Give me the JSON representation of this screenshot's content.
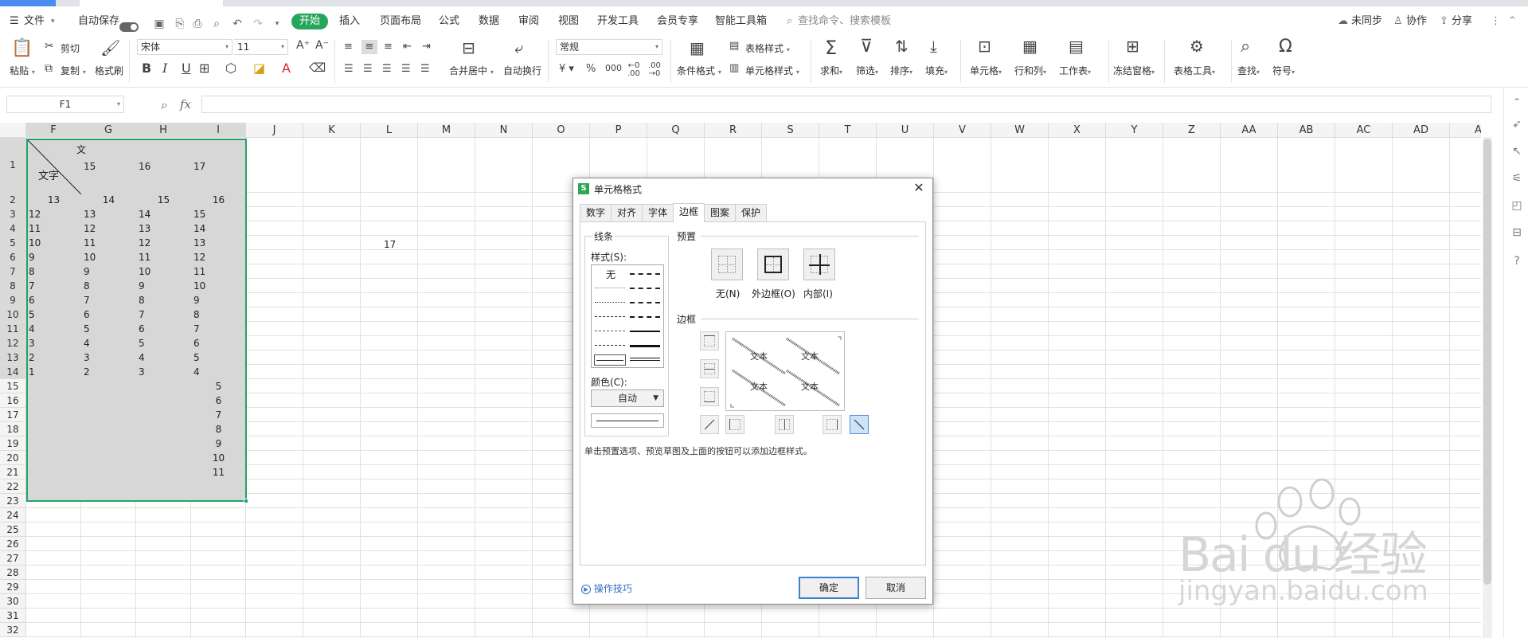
{
  "menubar": {
    "file": "文件",
    "autosave": "自动保存",
    "tabs": [
      "开始",
      "插入",
      "页面布局",
      "公式",
      "数据",
      "审阅",
      "视图",
      "开发工具",
      "会员专享",
      "智能工具箱"
    ],
    "search_placeholder": "查找命令、搜索模板",
    "sync": "未同步",
    "collab": "协作",
    "share": "分享"
  },
  "ribbon": {
    "paste": "粘贴",
    "cut": "剪切",
    "copy": "复制",
    "format_painter": "格式刷",
    "font_name": "宋体",
    "font_size": "11",
    "merge_center": "合并居中",
    "wrap": "自动换行",
    "number_format": "常规",
    "cond_format": "条件格式",
    "table_style": "表格样式",
    "cell_style": "单元格样式",
    "sum": "求和",
    "filter": "筛选",
    "sort": "排序",
    "fill": "填充",
    "cell": "单元格",
    "row_col": "行和列",
    "worksheet": "工作表",
    "freeze": "冻结窗格",
    "table_tools": "表格工具",
    "find": "查找",
    "symbol": "符号"
  },
  "formula": {
    "namebox": "F1",
    "fx": "fx"
  },
  "grid": {
    "columns": [
      "F",
      "G",
      "H",
      "I",
      "J",
      "K",
      "L",
      "M",
      "N",
      "O",
      "P",
      "Q",
      "R",
      "S",
      "T",
      "U",
      "V",
      "W",
      "X",
      "Y",
      "Z",
      "AA",
      "AB",
      "AC",
      "AD",
      "A"
    ],
    "rows": [
      "1",
      "2",
      "3",
      "4",
      "5",
      "6",
      "7",
      "8",
      "9",
      "10",
      "11",
      "12",
      "13",
      "14",
      "15",
      "16",
      "17",
      "18",
      "19",
      "20",
      "21",
      "22",
      "23",
      "24",
      "25",
      "26",
      "27",
      "28",
      "29",
      "30",
      "31",
      "32"
    ],
    "row1": {
      "diag_top": "文",
      "diag_bottom": "文字",
      "g": "15",
      "h": "16",
      "i": "17"
    },
    "row2": [
      "13",
      "14",
      "15",
      "16"
    ],
    "block": [
      [
        "12",
        "13",
        "14",
        "15"
      ],
      [
        "11",
        "12",
        "13",
        "14"
      ],
      [
        "10",
        "11",
        "12",
        "13"
      ],
      [
        "9",
        "10",
        "11",
        "12"
      ],
      [
        "8",
        "9",
        "10",
        "11"
      ],
      [
        "7",
        "8",
        "9",
        "10"
      ],
      [
        "6",
        "7",
        "8",
        "9"
      ],
      [
        "5",
        "6",
        "7",
        "8"
      ],
      [
        "4",
        "5",
        "6",
        "7"
      ],
      [
        "3",
        "4",
        "5",
        "6"
      ],
      [
        "2",
        "3",
        "4",
        "5"
      ],
      [
        "1",
        "2",
        "3",
        "4"
      ]
    ],
    "col_i_extra": [
      "5",
      "6",
      "7",
      "8",
      "9",
      "10",
      "11"
    ],
    "l5": "17"
  },
  "dialog": {
    "title": "单元格格式",
    "tabs": [
      "数字",
      "对齐",
      "字体",
      "边框",
      "图案",
      "保护"
    ],
    "active_tab": "边框",
    "line_group": "线条",
    "style_label": "样式(S):",
    "style_none": "无",
    "color_label": "颜色(C):",
    "color_value": "自动",
    "preset_group": "预置",
    "preset_none": "无(N)",
    "preset_outline": "外边框(O)",
    "preset_inside": "内部(I)",
    "border_group": "边框",
    "preview_text": "文本",
    "hint": "单击预置选项、预览草图及上面的按钮可以添加边框样式。",
    "tips": "操作技巧",
    "ok": "确定",
    "cancel": "取消"
  },
  "watermark": {
    "brand": "Bai  du 经验",
    "url": "jingyan.baidu.com"
  },
  "colors": {
    "accent_green": "#25a65a",
    "selection_border": "#21a366",
    "arrow_magenta": "#e23ae6"
  }
}
